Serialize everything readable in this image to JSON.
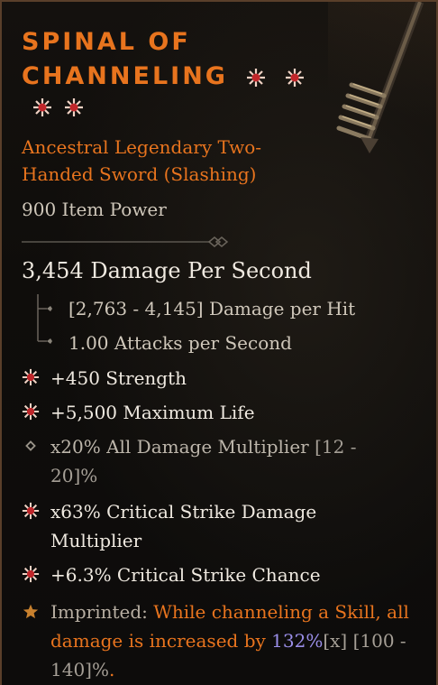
{
  "item": {
    "name_line1": "SPINAL OF",
    "name_line2": "CHANNELING",
    "type_line": "Ancestral Legendary Two-Handed Sword (Slashing)",
    "item_power": "900 Item Power",
    "sockets_icon": "sun-gem-icon"
  },
  "damage": {
    "dps": "3,454 Damage Per Second",
    "per_hit": "[2,763 - 4,145] Damage per Hit",
    "attack_speed": "1.00 Attacks per Second"
  },
  "affixes": [
    {
      "icon": "sun-gem-icon",
      "text": "+450 Strength"
    },
    {
      "icon": "sun-gem-icon",
      "text": "+5,500 Maximum Life"
    },
    {
      "icon": "diamond-bullet-icon",
      "text": "x20% All Damage Multiplier",
      "range": "[12 - 20]%"
    },
    {
      "icon": "sun-gem-icon",
      "text": "x63% Critical Strike Damage Multiplier"
    },
    {
      "icon": "sun-gem-icon",
      "text": "+6.3% Critical Strike Chance"
    }
  ],
  "imprint": {
    "icon": "star-icon",
    "label": "Imprinted: ",
    "text_a": "While channeling a Skill, all damage is increased by ",
    "value": "132%",
    "mult": "[x]",
    "range": "[100 - 140]%",
    "end": "."
  },
  "colors": {
    "legendary_orange": "#e8741e",
    "value_purple": "#9a8ee8",
    "border_brown": "#5a3f2a"
  }
}
